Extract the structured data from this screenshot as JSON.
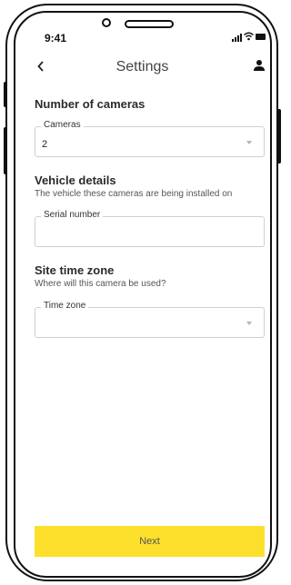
{
  "status_bar": {
    "time": "9:41"
  },
  "header": {
    "title": "Settings",
    "back_icon": "chevron-left-icon",
    "account_icon": "user-icon"
  },
  "sections": [
    {
      "title": "Number of cameras",
      "field": {
        "label": "Cameras",
        "value": "2",
        "type": "select"
      }
    },
    {
      "title": "Vehicle details",
      "subtitle": "The vehicle these cameras are being installed on",
      "field": {
        "label": "Serial number",
        "value": "",
        "type": "text"
      }
    },
    {
      "title": "Site time zone",
      "subtitle": "Where will this camera be used?",
      "field": {
        "label": "Time zone",
        "value": "",
        "type": "select"
      }
    }
  ],
  "footer": {
    "next_label": "Next"
  },
  "colors": {
    "accent": "#fce02b",
    "field_border": "#cfcfcf",
    "frame": "#111111"
  }
}
